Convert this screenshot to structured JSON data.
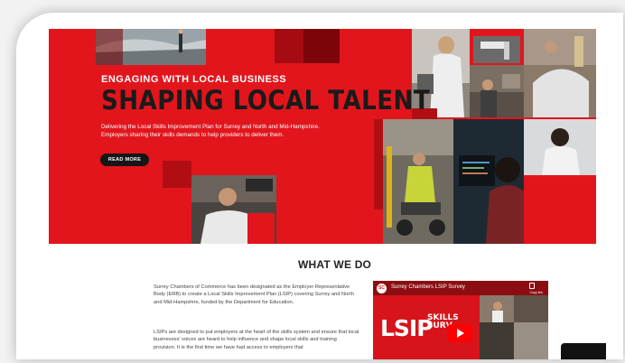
{
  "hero": {
    "kicker": "ENGAGING WITH LOCAL BUSINESS",
    "title": "SHAPING LOCAL TALENT",
    "description_1": "Delivering the Local Skills Improvement Plan for Surrey and North and Mid-Hampshire.",
    "description_2": "Employers sharing their skills demands to help providers to deliver them.",
    "read_more_label": "READ MORE"
  },
  "what_we_do": {
    "heading": "WHAT WE DO",
    "paragraph_1": "Surrey Chambers of Commerce has been designated as the Employer Representative Body (ERB) to create a Local Skills Improvement Plan (LSIP) covering Surrey and North and Mid-Hampshire, funded by the Department for Education.",
    "paragraph_2": "LSIPs are designed to put employers at the heart of the skills system and ensure that local businesses' voices are heard to help influence and shape local skills and training provision. It is the first time we have had access to employers that"
  },
  "video": {
    "title": "Surrey Chambers LSIP Survey",
    "copy_link_label": "Copy link",
    "big_text": "LSIP",
    "skills_text": "SKILLS",
    "survey_text": "SURV",
    "avatar_text": "SC"
  },
  "colors": {
    "brand_red": "#e2151c",
    "dark": "#1a1a1a"
  }
}
